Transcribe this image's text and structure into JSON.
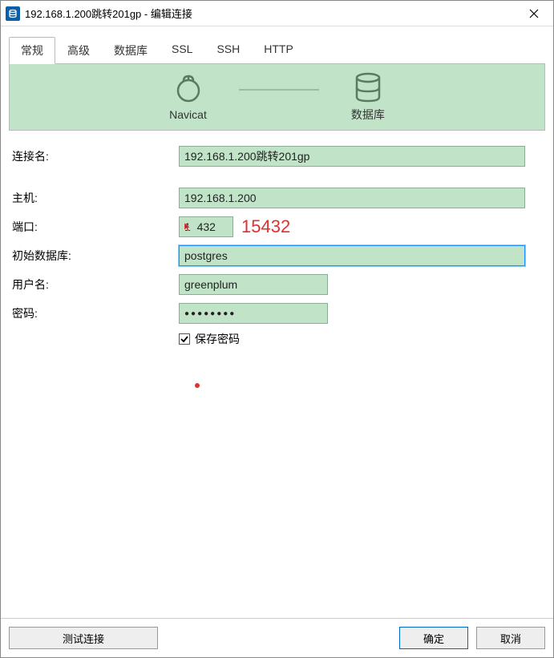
{
  "window": {
    "title": "192.168.1.200跳转201gp - 编辑连接"
  },
  "tabs": {
    "general": "常规",
    "advanced": "高级",
    "database": "数据库",
    "ssl": "SSL",
    "ssh": "SSH",
    "http": "HTTP"
  },
  "banner": {
    "navicat": "Navicat",
    "database": "数据库"
  },
  "form": {
    "connection_name_label": "连接名:",
    "connection_name_value": "192.168.1.200跳转201gp",
    "host_label": "主机:",
    "host_value": "192.168.1.200",
    "port_label": "端口:",
    "port_value": "1  432",
    "port_annotation": "15432",
    "initial_db_label": "初始数据库:",
    "initial_db_value": "postgres",
    "username_label": "用户名:",
    "username_value": "greenplum",
    "password_label": "密码:",
    "password_value": "●●●●●●●●",
    "save_password_label": "保存密码",
    "save_password_checked": true
  },
  "footer": {
    "test": "测试连接",
    "ok": "确定",
    "cancel": "取消"
  }
}
